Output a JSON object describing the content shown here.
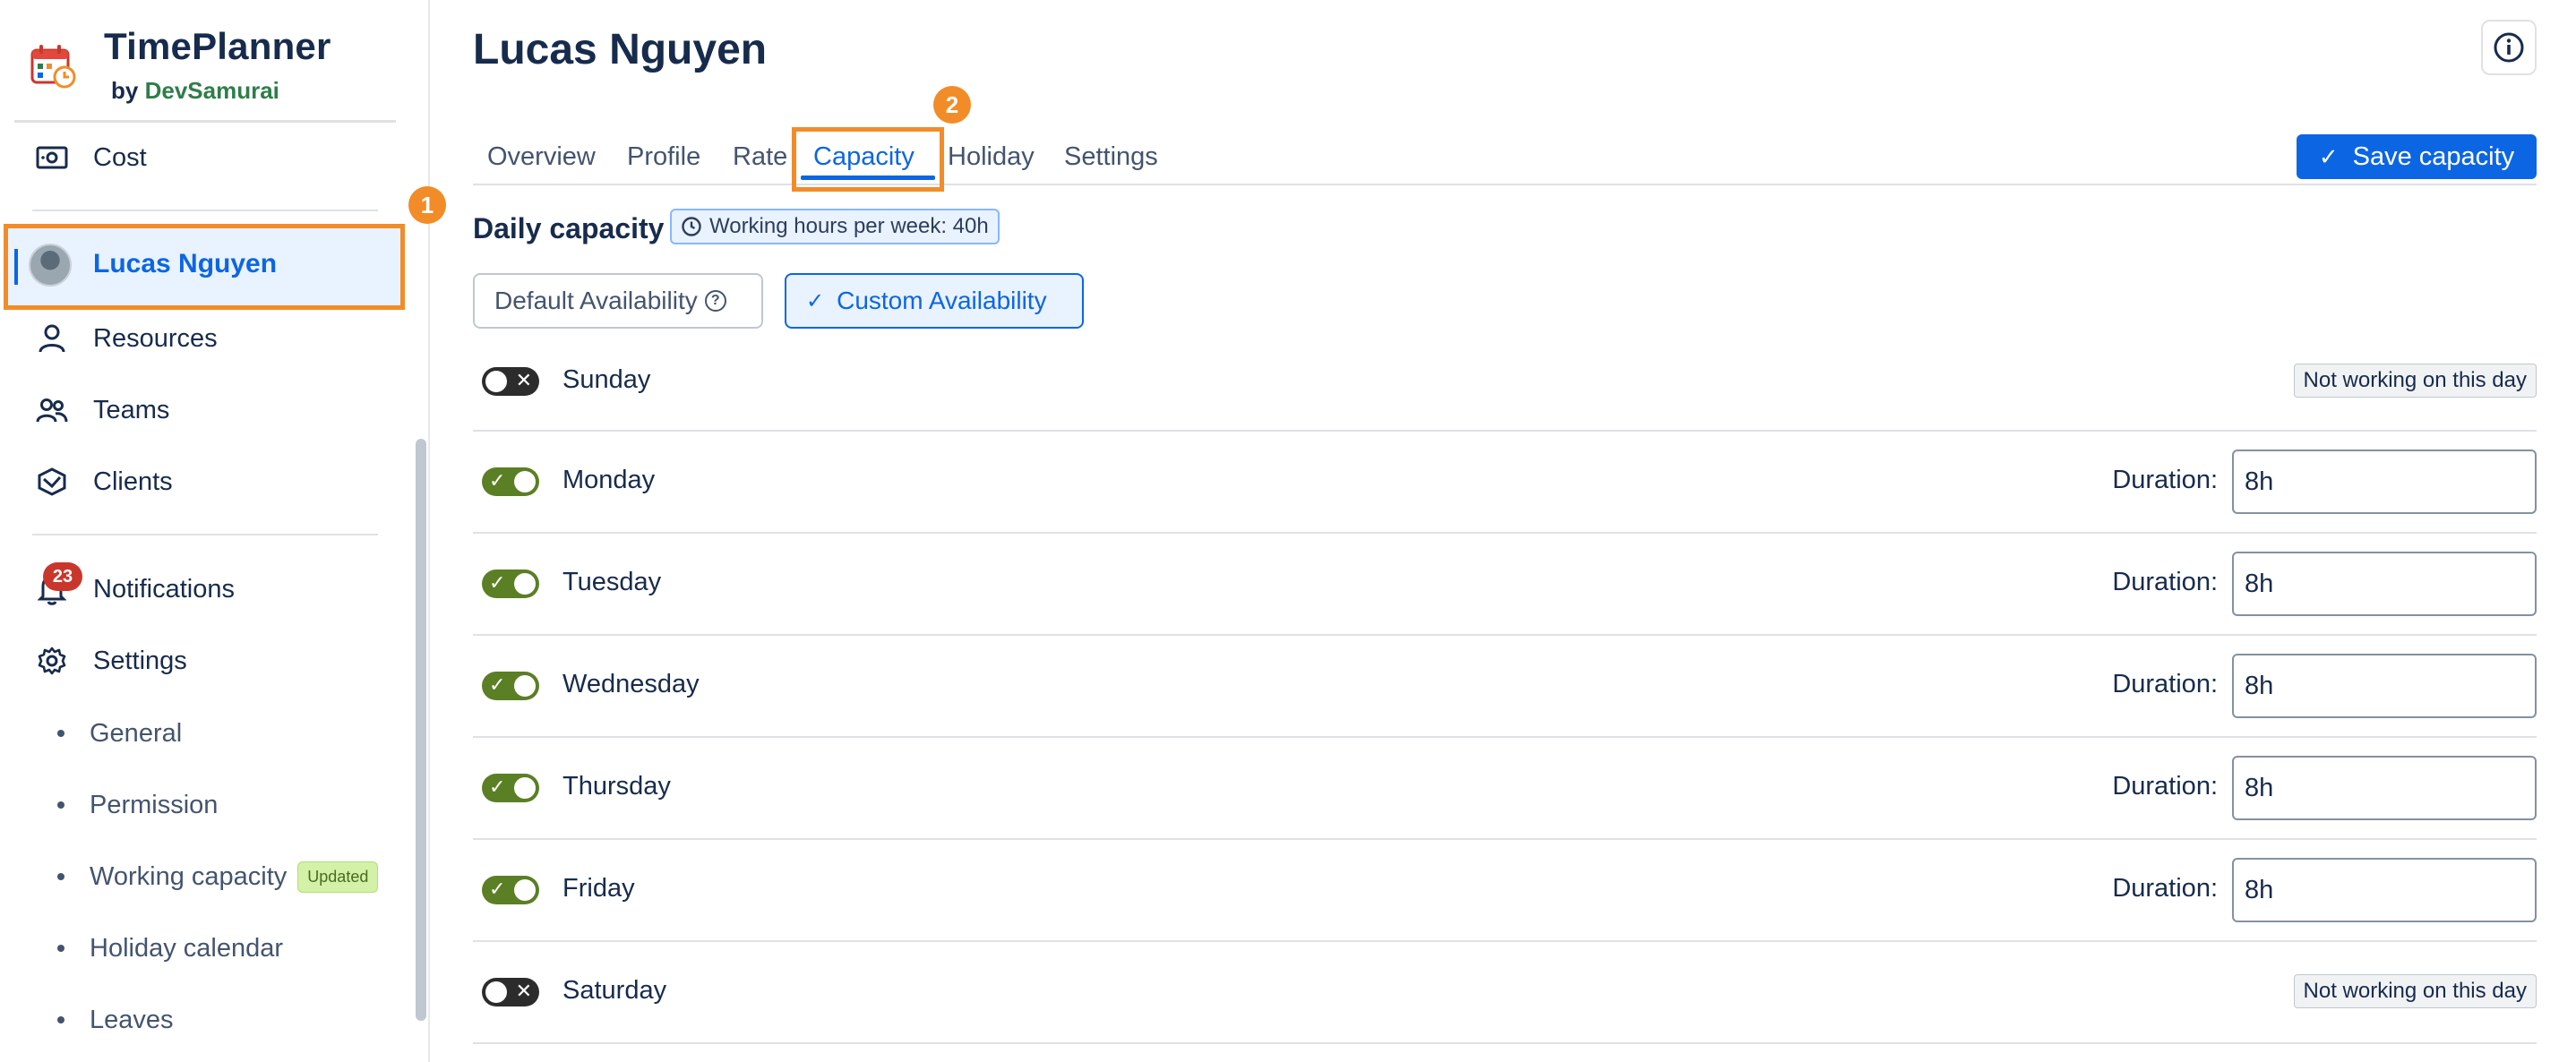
{
  "brand": {
    "title": "TimePlanner",
    "by": "by",
    "company": "DevSamurai"
  },
  "sidebar": {
    "items": [
      {
        "label": "Cost",
        "icon": "money-icon"
      },
      {
        "label": "Lucas Nguyen",
        "icon": "avatar",
        "active": true
      },
      {
        "label": "Resources",
        "icon": "user-icon"
      },
      {
        "label": "Teams",
        "icon": "team-icon"
      },
      {
        "label": "Clients",
        "icon": "handshake-icon"
      },
      {
        "label": "Notifications",
        "icon": "bell-icon",
        "badge": "23"
      },
      {
        "label": "Settings",
        "icon": "gear-icon"
      }
    ],
    "settings_sub": [
      {
        "label": "General"
      },
      {
        "label": "Permission"
      },
      {
        "label": "Working capacity",
        "tag": "Updated"
      },
      {
        "label": "Holiday calendar"
      },
      {
        "label": "Leaves"
      }
    ]
  },
  "steps": {
    "one": "1",
    "two": "2"
  },
  "main": {
    "title": "Lucas Nguyen",
    "tabs": [
      {
        "label": "Overview"
      },
      {
        "label": "Profile"
      },
      {
        "label": "Rate"
      },
      {
        "label": "Capacity",
        "active": true
      },
      {
        "label": "Holiday"
      },
      {
        "label": "Settings"
      }
    ],
    "save_label": "Save capacity",
    "daily_title": "Daily capacity",
    "hours_pill": "Working hours per week: 40h",
    "default_availability": "Default Availability",
    "custom_availability": "Custom Availability",
    "duration_label": "Duration:",
    "not_working_label": "Not working on this day",
    "days": [
      {
        "name": "Sunday",
        "enabled": false,
        "duration": ""
      },
      {
        "name": "Monday",
        "enabled": true,
        "duration": "8h"
      },
      {
        "name": "Tuesday",
        "enabled": true,
        "duration": "8h"
      },
      {
        "name": "Wednesday",
        "enabled": true,
        "duration": "8h"
      },
      {
        "name": "Thursday",
        "enabled": true,
        "duration": "8h"
      },
      {
        "name": "Friday",
        "enabled": true,
        "duration": "8h"
      },
      {
        "name": "Saturday",
        "enabled": false,
        "duration": ""
      }
    ]
  },
  "colors": {
    "accent": "#0c66e4",
    "highlight": "#f28c28",
    "toggle_on": "#5b7f24",
    "badge": "#c9372c"
  }
}
